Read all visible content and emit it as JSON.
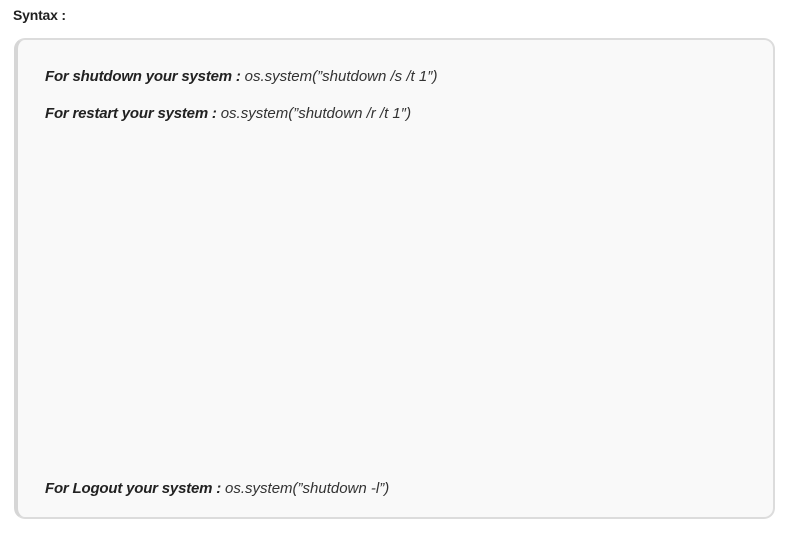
{
  "heading": "Syntax :",
  "lines": [
    {
      "label": "For shutdown your system : ",
      "code": "os.system(”shutdown /s /t 1″)"
    },
    {
      "label": "For restart your system : ",
      "code": "os.system(”shutdown /r /t 1″)"
    },
    {
      "label": "For Logout your system : ",
      "code": "os.system(”shutdown -l”)"
    }
  ]
}
